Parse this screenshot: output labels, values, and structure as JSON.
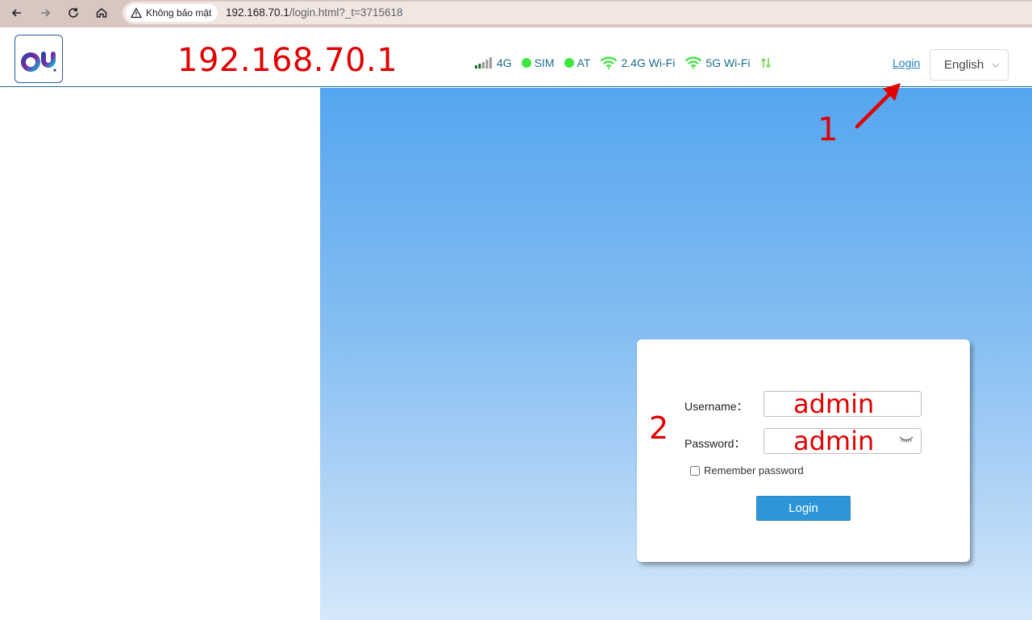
{
  "browser": {
    "security_label": "Không bảo mật",
    "url_host": "192.168.70.1",
    "url_path": "/login.html?_t=3715618"
  },
  "header": {
    "ip_title": "192.168.70.1",
    "status": {
      "network": "4G",
      "sim": "SIM",
      "at": "AT",
      "wifi_24": "2.4G Wi-Fi",
      "wifi_5": "5G Wi-Fi"
    },
    "login_link": "Login",
    "language": "English"
  },
  "annotations": {
    "step1": "1",
    "step2": "2"
  },
  "login_form": {
    "username_label": "Username：",
    "username_value": "admin",
    "password_label": "Password：",
    "password_value": "admin",
    "remember_label": "Remember password",
    "remember_checked": false,
    "submit_label": "Login"
  },
  "colors": {
    "annotation_red": "#e00000",
    "status_green": "#3ee63e",
    "link_blue": "#1e7fc2",
    "button_blue": "#2d96d9"
  },
  "icons": {
    "back": "arrow-left-icon",
    "forward": "arrow-right-icon",
    "reload": "reload-icon",
    "home": "home-icon",
    "warning": "warning-triangle-icon",
    "signal": "signal-bars-icon",
    "wifi": "wifi-icon",
    "transfer": "up-down-arrows-icon",
    "eye": "eye-closed-icon"
  }
}
